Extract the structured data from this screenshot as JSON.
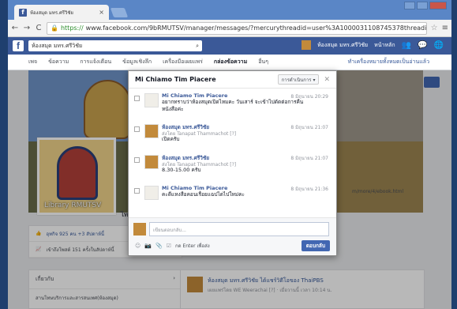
{
  "browser": {
    "tab_title": "ห้องสมุด มทร.ศรีวิชัย",
    "url_scheme": "https://",
    "url_rest": "www.facebook.com/9bRMUTSV/manager/messages/?mercurythreadid=user%3A1000031108745378threadid=1000031"
  },
  "fb": {
    "search_text": "ห้องสมุด มทร.ศรีวิชัย",
    "page_name": "ห้องสมุด มทร.ศรีวิชัย",
    "home": "หน้าหลัก"
  },
  "pagenav": {
    "items": [
      "เพจ",
      "ข้อความ",
      "การแจ้งเตือน",
      "ข้อมูลเชิงลึก",
      "เครื่องมือเผยแพร่",
      "กล่องข้อความ",
      "อื่นๆ"
    ],
    "right_link": "ทำเครื่องหมายทั้งหมดเป็นอ่านแล้ว"
  },
  "background": {
    "profile_caption": "Library RMUTSV",
    "timeline_label": "ไทม์",
    "left_row1": "ชุบมือเปิบ",
    "left_row1_count": "อุทกิจ 925 คน +3 สัปดาห์นี้",
    "left_row2": "เข้าถึงโพสต์ 151 ครั้งในสัปดาห์นี้",
    "left_hd": "เกี่ยวกับ",
    "left_item": "สานโทษบริการและสารสนเทศ(ห้องสมุด)",
    "post_line": "ห้องสมุด มทร.ศรีวิชัย ได้แชร์วิดีโอของ ThaiPBS",
    "post_sub": "เผยแพร่โดย WE Weerachai [?] · เมื่อวานนี้ เวลา 10:14 น.",
    "right_link": "m/more/4/ebook.html",
    "right_blk": "สร้าง"
  },
  "dialog": {
    "title": "Mi Chiamo Tim Piacere",
    "actions_label": "การดำเนินการ ▾",
    "messages": [
      {
        "name": "Mi Chiamo Tim Piacere",
        "time": "8 มิถุนายน 20:29",
        "line1": "อยากทราบว่าห้องสมุดเปิดไหมคะ วันเสาร์ จะเข้าไปดัดต่อการคืน",
        "line2": "หนังสือค่ะ"
      },
      {
        "name": "ห้องสมุด มทร.ศรีวิชัย",
        "time": "8 มิถุนายน 21:07",
        "by": "ส่งโดย Tanapat Thammachot [?]",
        "line2": "เปิดครับ"
      },
      {
        "name": "ห้องสมุด มทร.ศรีวิชัย",
        "time": "8 มิถุนายน 21:07",
        "by": "ส่งโดย Tanapat Thammachot [?]",
        "line2": "8.30-15.00 ครับ"
      },
      {
        "name": "Mi Chiamo Tim Piacere",
        "time": "8 มิถุนายน 21:36",
        "line1": "คะดีแหงสือคอนเรื่อยแฉปไดไปใหม่คะ"
      }
    ],
    "composer_placeholder": "เขียนตอบกลับ...",
    "enter_label": "กด Enter เพื่อส่ง",
    "reply_button": "ตอบกลับ"
  }
}
